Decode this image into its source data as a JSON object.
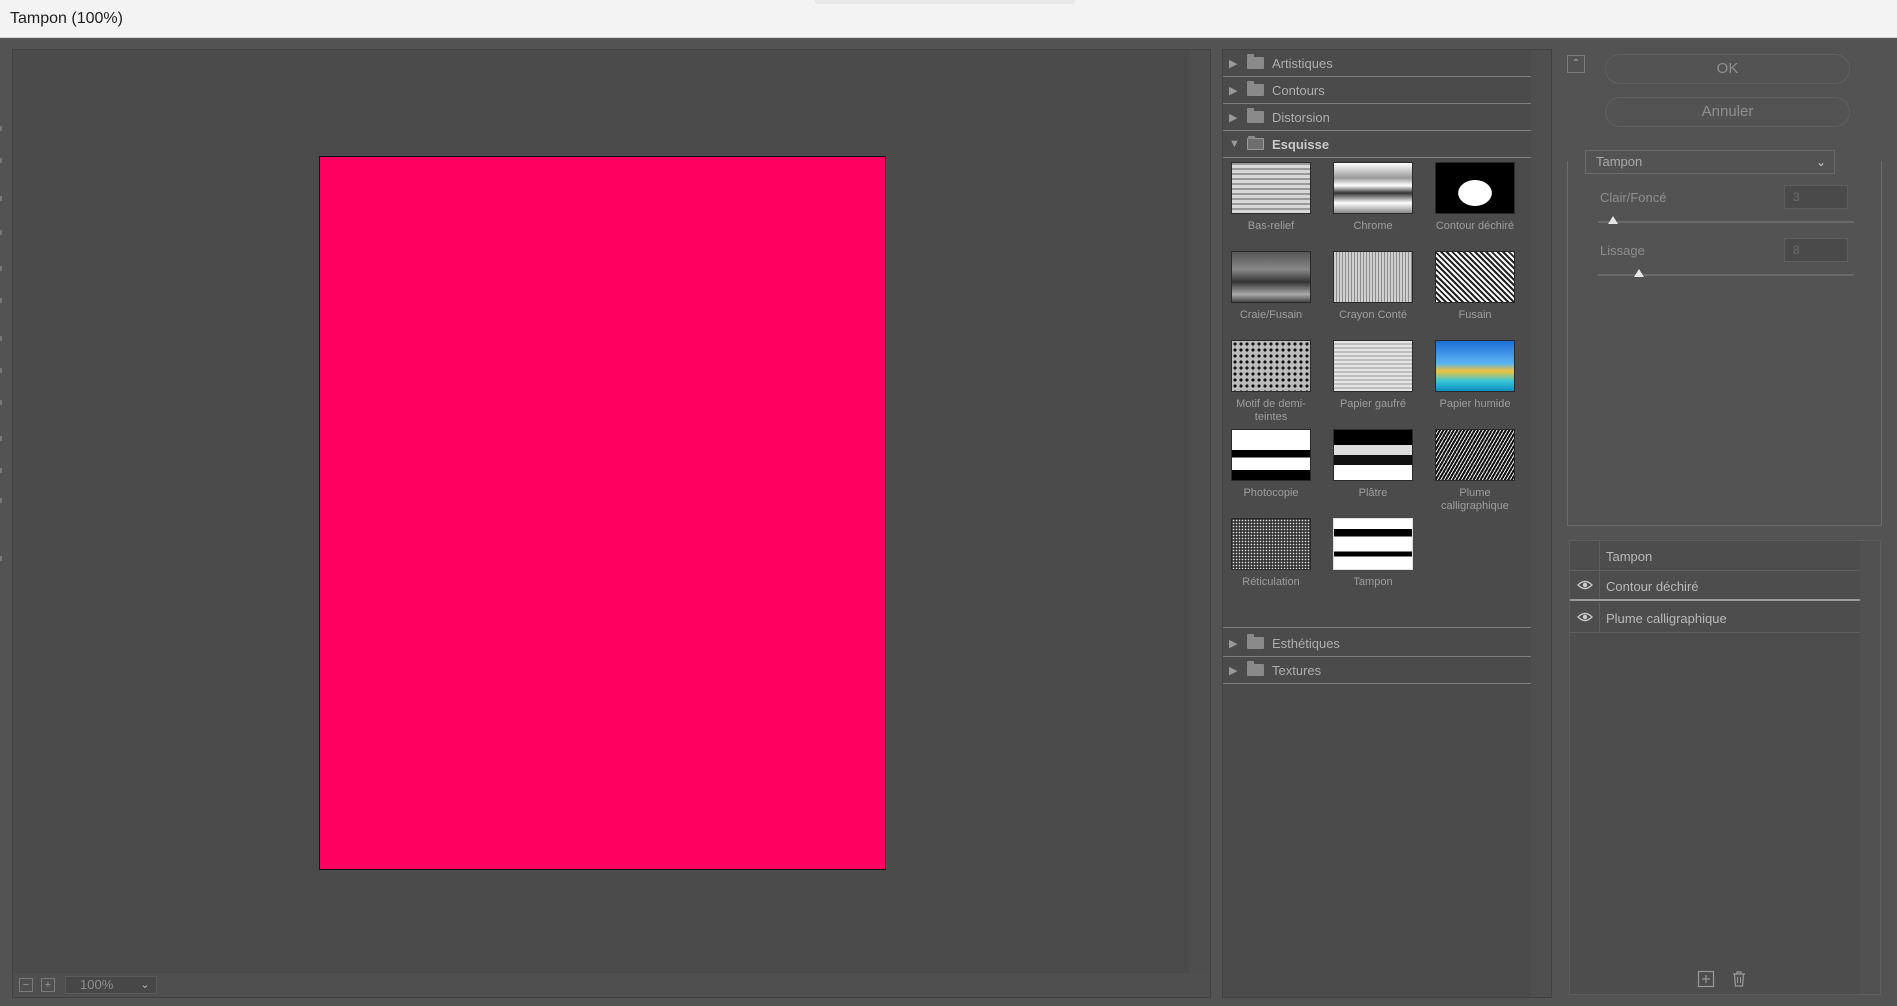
{
  "window": {
    "title": "Tampon (100%)"
  },
  "preview": {
    "image_color": "#ff005f",
    "zoom": {
      "value": "100%",
      "minus_label": "−",
      "plus_label": "+"
    }
  },
  "gallery": {
    "categories_top": [
      {
        "label": "Artistiques"
      },
      {
        "label": "Contours"
      },
      {
        "label": "Distorsion"
      }
    ],
    "open_category": {
      "label": "Esquisse",
      "filters": [
        {
          "label": "Bas-relief"
        },
        {
          "label": "Chrome"
        },
        {
          "label": "Contour déchiré"
        },
        {
          "label": "Craie/Fusain"
        },
        {
          "label": "Crayon Conté"
        },
        {
          "label": "Fusain"
        },
        {
          "label": "Motif de demi-teintes"
        },
        {
          "label": "Papier gaufré"
        },
        {
          "label": "Papier humide"
        },
        {
          "label": "Photocopie"
        },
        {
          "label": "Plâtre"
        },
        {
          "label": "Plume calligraphique"
        },
        {
          "label": "Réticulation"
        },
        {
          "label": "Tampon"
        }
      ]
    },
    "categories_bottom": [
      {
        "label": "Esthétiques"
      },
      {
        "label": "Textures"
      }
    ]
  },
  "actions": {
    "ok_label": "OK",
    "cancel_label": "Annuler"
  },
  "settings": {
    "filter_select": "Tampon",
    "params": [
      {
        "label": "Clair/Foncé",
        "value": "3",
        "max": 50
      },
      {
        "label": "Lissage",
        "value": "8",
        "max": 50
      }
    ]
  },
  "layers": {
    "header": "Tampon",
    "items": [
      {
        "label": "Contour déchiré",
        "visible": true
      },
      {
        "label": "Plume calligraphique",
        "visible": true
      }
    ]
  }
}
